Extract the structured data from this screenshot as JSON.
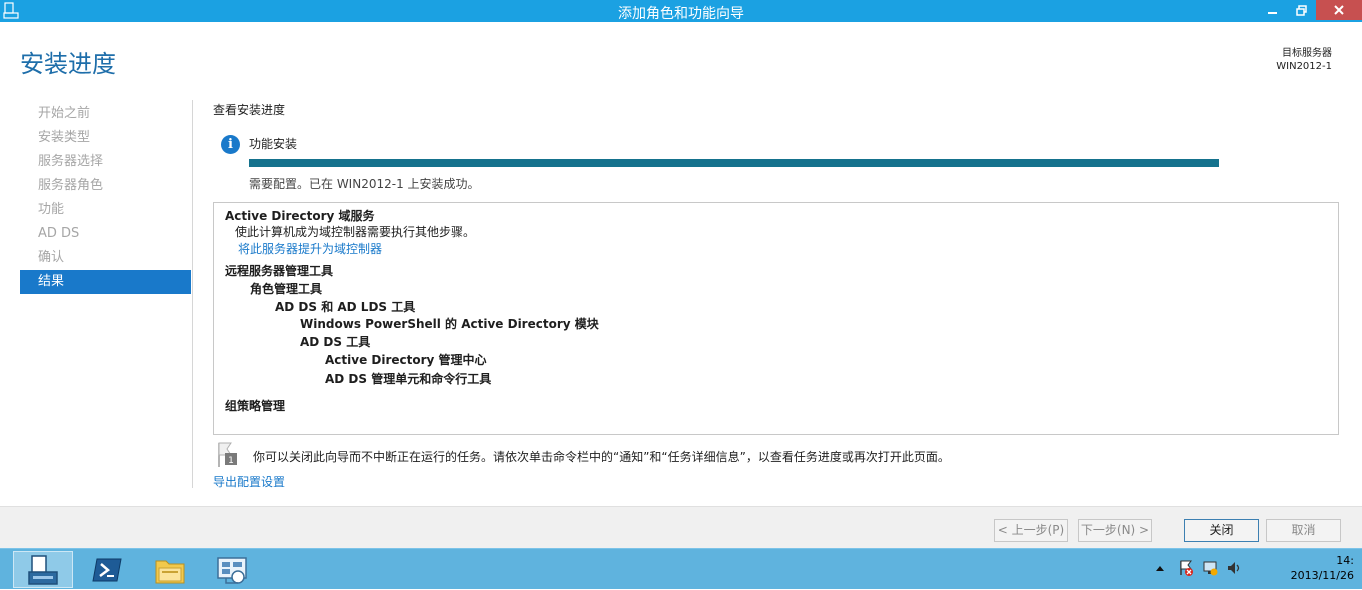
{
  "window": {
    "title": "添加角色和功能向导",
    "controls": {
      "min": "minimize-icon",
      "max": "restore-icon",
      "close": "close-icon"
    }
  },
  "page": {
    "heading": "安装进度",
    "target_label": "目标服务器",
    "target_server": "WIN2012-1"
  },
  "nav": {
    "items": [
      {
        "label": "开始之前",
        "active": false
      },
      {
        "label": "安装类型",
        "active": false
      },
      {
        "label": "服务器选择",
        "active": false
      },
      {
        "label": "服务器角色",
        "active": false
      },
      {
        "label": "功能",
        "active": false
      },
      {
        "label": "AD DS",
        "active": false
      },
      {
        "label": "确认",
        "active": false
      },
      {
        "label": "结果",
        "active": true
      }
    ]
  },
  "content": {
    "section_title": "查看安装进度",
    "feature_label": "功能安装",
    "progress": 1.0,
    "status": "需要配置。已在 WIN2012-1 上安装成功。",
    "results": [
      {
        "text": "Active Directory 域服务",
        "bold": true,
        "link": false
      },
      {
        "text": "使此计算机成为域控制器需要执行其他步骤。",
        "bold": false,
        "link": false
      },
      {
        "text": "将此服务器提升为域控制器",
        "bold": false,
        "link": true
      },
      {
        "text": "远程服务器管理工具",
        "bold": true,
        "link": false
      },
      {
        "text": "角色管理工具",
        "bold": true,
        "link": false
      },
      {
        "text": "AD DS 和 AD LDS 工具",
        "bold": true,
        "link": false
      },
      {
        "text": "Windows PowerShell 的 Active Directory 模块",
        "bold": true,
        "link": false
      },
      {
        "text": "AD DS 工具",
        "bold": true,
        "link": false
      },
      {
        "text": "Active Directory 管理中心",
        "bold": true,
        "link": false
      },
      {
        "text": "AD DS 管理单元和命令行工具",
        "bold": true,
        "link": false
      },
      {
        "text": "组策略管理",
        "bold": true,
        "link": false
      }
    ],
    "note": "你可以关闭此向导而不中断正在运行的任务。请依次单击命令栏中的“通知”和“任务详细信息”，以查看任务进度或再次打开此页面。",
    "note_badge": "1",
    "export_link": "导出配置设置"
  },
  "footer": {
    "prev": "< 上一步(P)",
    "next": "下一步(N) >",
    "close": "关闭",
    "cancel": "取消"
  },
  "taskbar": {
    "apps": [
      "server-manager-icon",
      "powershell-icon",
      "file-explorer-icon",
      "control-panel-icon"
    ],
    "tray_icons": [
      "show-hidden-icons-icon",
      "action-center-icon",
      "network-icon",
      "volume-icon"
    ],
    "time": "14:",
    "date": "2013/11/26"
  },
  "colors": {
    "titlebar": "#1ba1e2",
    "accent": "#1979ca",
    "progress": "#15728d",
    "taskbar": "#5fb3de"
  }
}
